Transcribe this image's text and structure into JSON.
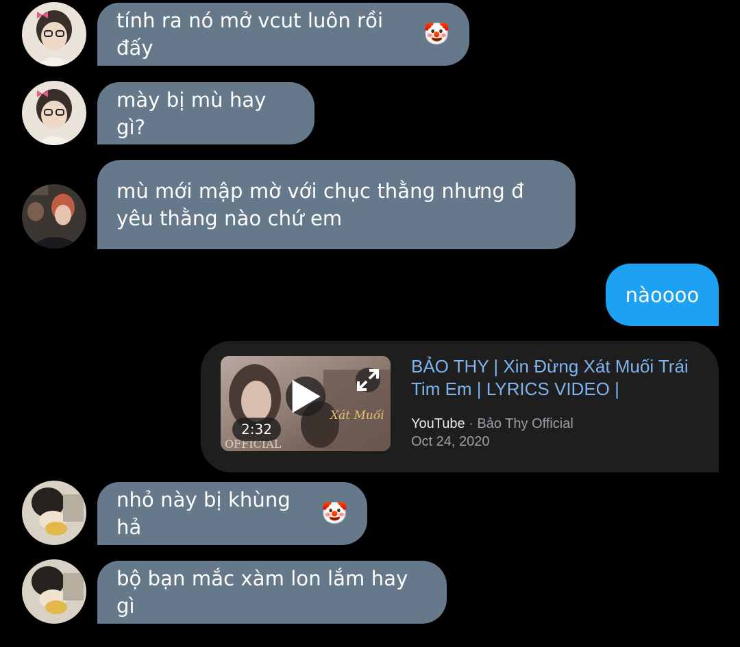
{
  "messages": [
    {
      "text": "tính ra nó mở vcut luôn rồi đấy",
      "emoji": "🤡"
    },
    {
      "text": "mày bị mù hay gì?"
    },
    {
      "line1": "mù mới mập mờ với chục thằng nhưng đ",
      "line2": "yêu thằng nào chứ em"
    },
    {
      "text": "nàoooo"
    },
    {
      "text": "nhỏ này bị khùng hả",
      "emoji": "🤡"
    },
    {
      "text": "bộ bạn mắc xàm lon lắm hay gì"
    }
  ],
  "link_card": {
    "title_line1": "BẢO THY | Xin Đừng Xát Muối Trái",
    "title_line2": "Tim Em | LYRICS VIDEO |",
    "site": "YouTube",
    "separator": " · ",
    "channel": "Bảo Thy Official",
    "date": "Oct 24, 2020",
    "duration": "2:32",
    "thumbnail_text_1": "Xát Muối",
    "thumbnail_text_2": "OFFICIAL"
  },
  "icons": {
    "play": "play-icon",
    "expand": "expand-icon"
  },
  "colors": {
    "background": "#000000",
    "incoming_bubble": "#66798a",
    "outgoing_bubble": "#1da1f2",
    "card_background": "#1e1e1e",
    "link_title": "#7fb4ef",
    "meta_text": "#9aa0a6"
  }
}
